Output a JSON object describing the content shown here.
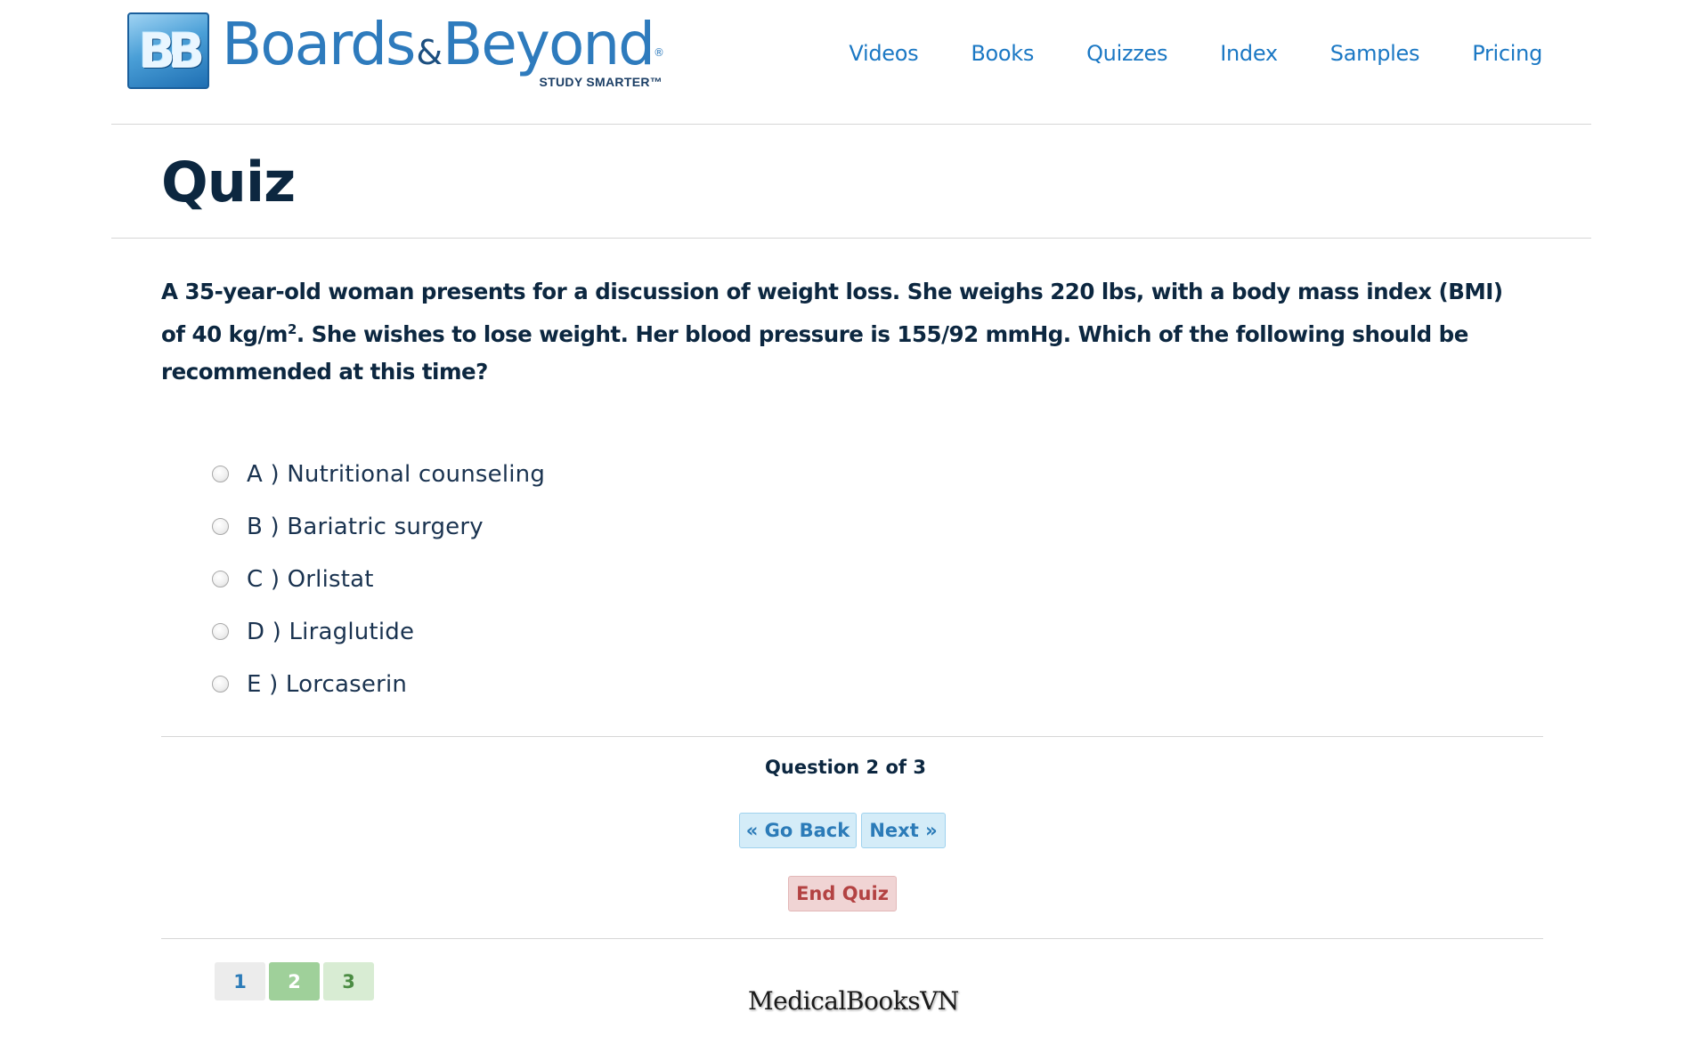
{
  "brand": {
    "badge": "BB",
    "name_part1": "Boards",
    "name_amp": "&",
    "name_part2": "Beyond",
    "registered": "®",
    "tagline": "STUDY SMARTER™"
  },
  "nav": {
    "items": [
      "Videos",
      "Books",
      "Quizzes",
      "Index",
      "Samples",
      "Pricing"
    ]
  },
  "page": {
    "title": "Quiz"
  },
  "question": {
    "text_before_sup": "A 35-year-old woman presents for a discussion of weight loss. She weighs 220 lbs, with a body mass index (BMI) of 40 kg/m",
    "sup": "2",
    "text_after_sup": ". She wishes to lose weight. Her blood pressure is 155/92 mmHg. Which of the following should be recommended at this time?"
  },
  "answers": [
    "A ) Nutritional counseling",
    "B ) Bariatric surgery",
    "C ) Orlistat",
    "D ) Liraglutide",
    "E ) Lorcaserin"
  ],
  "progress": {
    "label": "Question 2 of 3",
    "current": 2,
    "total": 3
  },
  "buttons": {
    "back": "« Go Back",
    "next": "Next »",
    "end": "End Quiz"
  },
  "pages": [
    "1",
    "2",
    "3"
  ],
  "watermark": "MedicalBooksVN",
  "colors": {
    "nav_link": "#1b78c4",
    "heading": "#0c2740",
    "nav_button_bg": "#d4ecf8",
    "end_button_bg": "#f0d4d4",
    "current_page_bg": "#9fd09a",
    "answered_page_bg": "#d8ecd3"
  }
}
